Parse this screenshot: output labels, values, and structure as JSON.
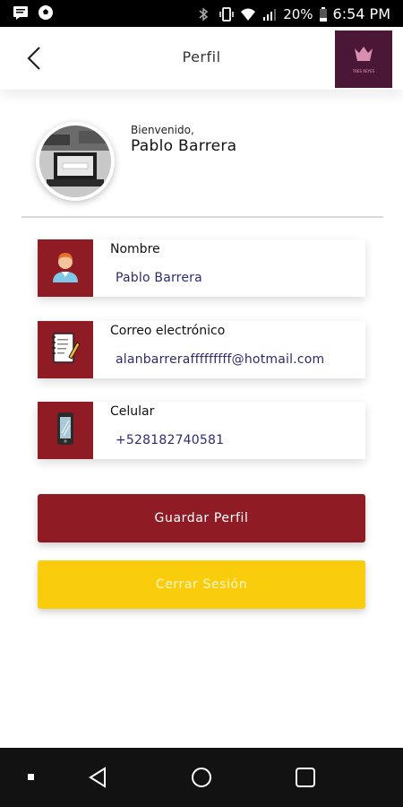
{
  "status_bar": {
    "battery": "20%",
    "time": "6:54 PM",
    "icons": [
      "messages-icon",
      "soccer-icon",
      "bluetooth-icon",
      "vibrate-icon",
      "wifi-icon",
      "signal-icon",
      "battery-icon"
    ]
  },
  "header": {
    "title": "Perfil",
    "back_icon": "chevron-left-icon",
    "logo_text": "TRES REYES"
  },
  "profile": {
    "welcome": "Bienvenido,",
    "name": "Pablo Barrera"
  },
  "fields": [
    {
      "label": "Nombre",
      "value": "Pablo Barrera",
      "icon": "person-icon"
    },
    {
      "label": "Correo electrónico",
      "value": "alanbarrerafffffffff@hotmail.com",
      "icon": "notepad-icon"
    },
    {
      "label": "Celular",
      "value": "+528182740581",
      "icon": "smartphone-icon"
    }
  ],
  "buttons": {
    "save": "Guardar Perfil",
    "logout": "Cerrar Sesión"
  },
  "nav": [
    "square-dot-icon",
    "back-triangle-icon",
    "home-circle-icon",
    "recents-square-icon"
  ],
  "colors": {
    "accent": "#8f1c24",
    "logout": "#f9cd0c",
    "logo_bg": "#4a1836",
    "value_text": "#2c2c6e"
  }
}
